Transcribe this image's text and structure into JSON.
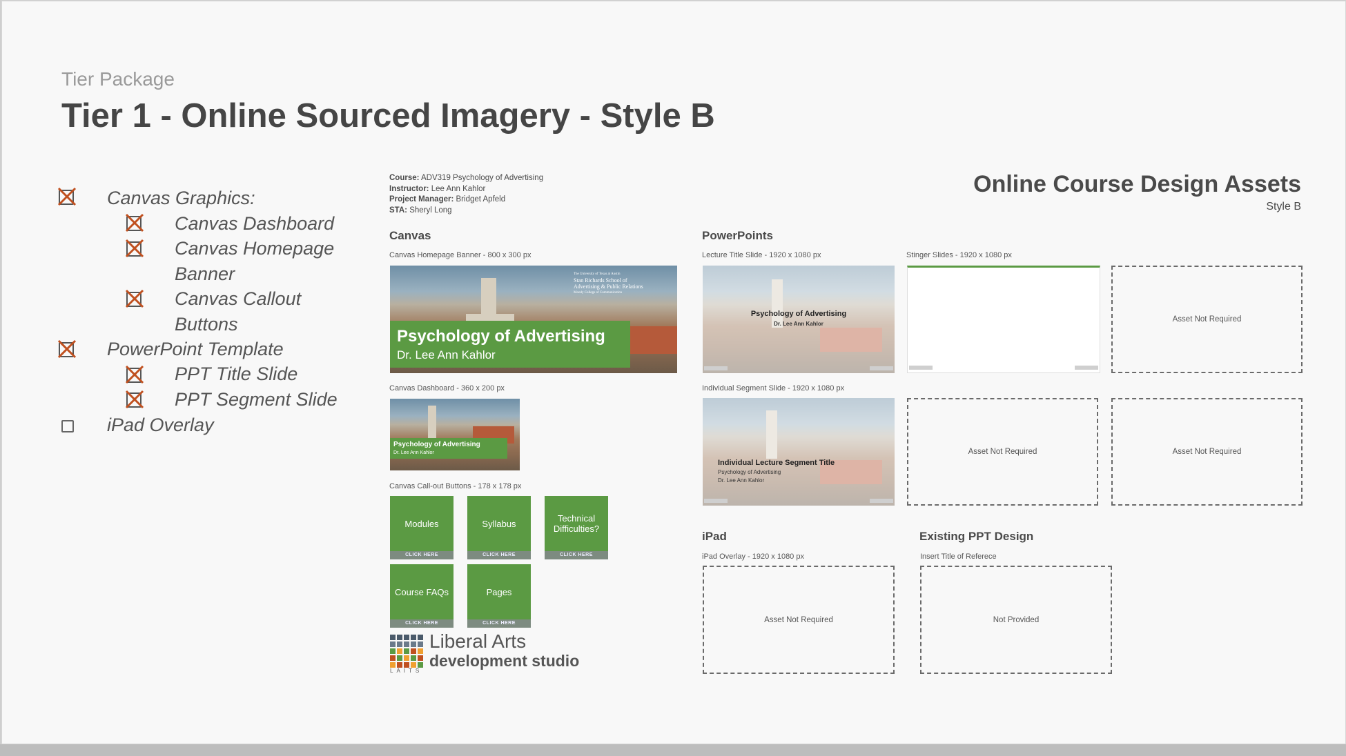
{
  "header": {
    "eyebrow": "Tier Package",
    "title": "Tier 1 - Online Sourced Imagery - Style B"
  },
  "checklist": [
    {
      "label": "Canvas Graphics:",
      "checked": true
    },
    {
      "label": "Canvas Dashboard",
      "checked": true
    },
    {
      "label": "Canvas Homepage",
      "label2": "Banner",
      "checked": true
    },
    {
      "label": "Canvas Callout",
      "label2": "Buttons",
      "checked": true
    },
    {
      "label": "PowerPoint Template",
      "checked": true
    },
    {
      "label": "PPT Title Slide",
      "checked": true
    },
    {
      "label": "PPT Segment Slide",
      "checked": true
    },
    {
      "label": "iPad Overlay",
      "checked": false
    }
  ],
  "course_info": {
    "course_label": "Course:",
    "course": "ADV319 Psychology of Advertising",
    "instructor_label": "Instructor:",
    "instructor": "Lee Ann Kahlor",
    "pm_label": "Project Manager:",
    "pm": "Bridget Apfeld",
    "sta_label": "STA:",
    "sta": "Sheryl Long"
  },
  "assets_header": {
    "title": "Online Course Design Assets",
    "style": "Style B"
  },
  "canvas": {
    "section": "Canvas",
    "banner_label": "Canvas Homepage Banner - 800 x 300 px",
    "banner_title": "Psychology of Advertising",
    "banner_subtitle": "Dr. Lee Ann Kahlor",
    "banner_logo_line1": "The University of Texas at Austin",
    "banner_logo_line2": "Stan Richards School of",
    "banner_logo_line3": "Advertising & Public Relations",
    "banner_logo_line4": "Moody College of Communication",
    "dashboard_label": "Canvas Dashboard - 360 x 200 px",
    "dashboard_title": "Psychology of Advertising",
    "dashboard_subtitle": "Dr. Lee Ann Kahlor",
    "buttons_label": "Canvas Call-out Buttons - 178 x 178 px",
    "buttons": [
      {
        "label": "Modules",
        "cta": "CLICK HERE"
      },
      {
        "label": "Syllabus",
        "cta": "CLICK HERE"
      },
      {
        "label": "Technical Difficulties?",
        "cta": "CLICK HERE"
      },
      {
        "label": "Course FAQs",
        "cta": "CLICK HERE"
      },
      {
        "label": "Pages",
        "cta": "CLICK HERE"
      }
    ]
  },
  "logo": {
    "line1": "Liberal Arts",
    "line2": "development studio",
    "tag": "LAITS"
  },
  "powerpoints": {
    "section": "PowerPoints",
    "title_slide_label": "Lecture Title Slide - 1920 x 1080 px",
    "title_slide_title": "Psychology of Advertising",
    "title_slide_subtitle": "Dr. Lee Ann Kahlor",
    "stinger_label": "Stinger Slides - 1920 x 1080 px",
    "segment_label": "Individual Segment Slide - 1920 x 1080 px",
    "segment_title": "Individual Lecture Segment Title",
    "segment_line2": "Psychology of Advertising",
    "segment_line3": "Dr. Lee Ann Kahlor",
    "not_required": "Asset Not Required"
  },
  "ipad": {
    "section": "iPad",
    "label": "iPad Overlay - 1920 x 1080 px",
    "placeholder": "Asset Not Required"
  },
  "existing": {
    "section": "Existing PPT Design",
    "label": "Insert Title of Referece",
    "placeholder": "Not Provided"
  },
  "colors": {
    "green": "#5b9a43",
    "check_x": "#c0501f",
    "text": "#424242"
  }
}
